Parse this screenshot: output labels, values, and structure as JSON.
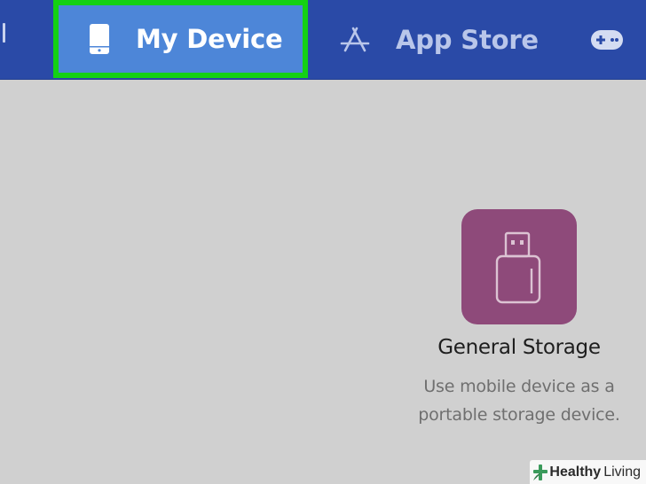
{
  "nav": {
    "tabs": [
      {
        "label": "My Device",
        "icon": "phone-icon",
        "selected": true
      },
      {
        "label": "App Store",
        "icon": "app-store-icon",
        "selected": false
      },
      {
        "label": "",
        "icon": "gamepad-icon",
        "selected": false
      }
    ]
  },
  "storage": {
    "icon": "usb-drive-icon",
    "title": "General Storage",
    "description_line1": "Use mobile device as a",
    "description_line2": "portable storage device."
  },
  "watermark": {
    "part1": "Healthy",
    "part2": "Living"
  },
  "colors": {
    "topbar": "#2a4aa7",
    "selected_tab": "#4d86d8",
    "highlight_border": "#14d114",
    "background": "#d0d0d0",
    "storage_tile": "#8e4a7a"
  }
}
